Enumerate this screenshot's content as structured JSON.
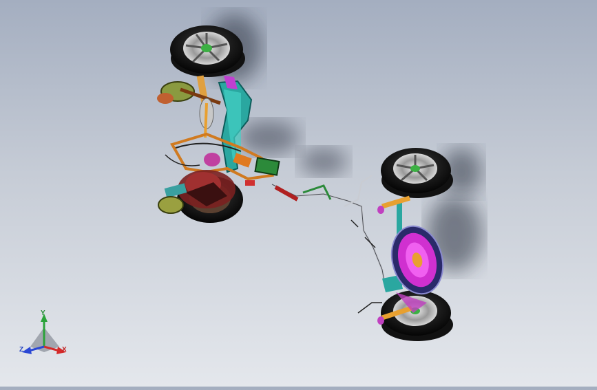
{
  "scene": {
    "background_top": "#a4aec0",
    "background_bottom": "#e4e7ec",
    "model": "chassis-assembly"
  },
  "triad": {
    "x_label": "X",
    "y_label": "Y",
    "z_label": "Z",
    "x_color": "#d42a2a",
    "y_color": "#2aa33a",
    "z_color": "#2a47d4"
  }
}
